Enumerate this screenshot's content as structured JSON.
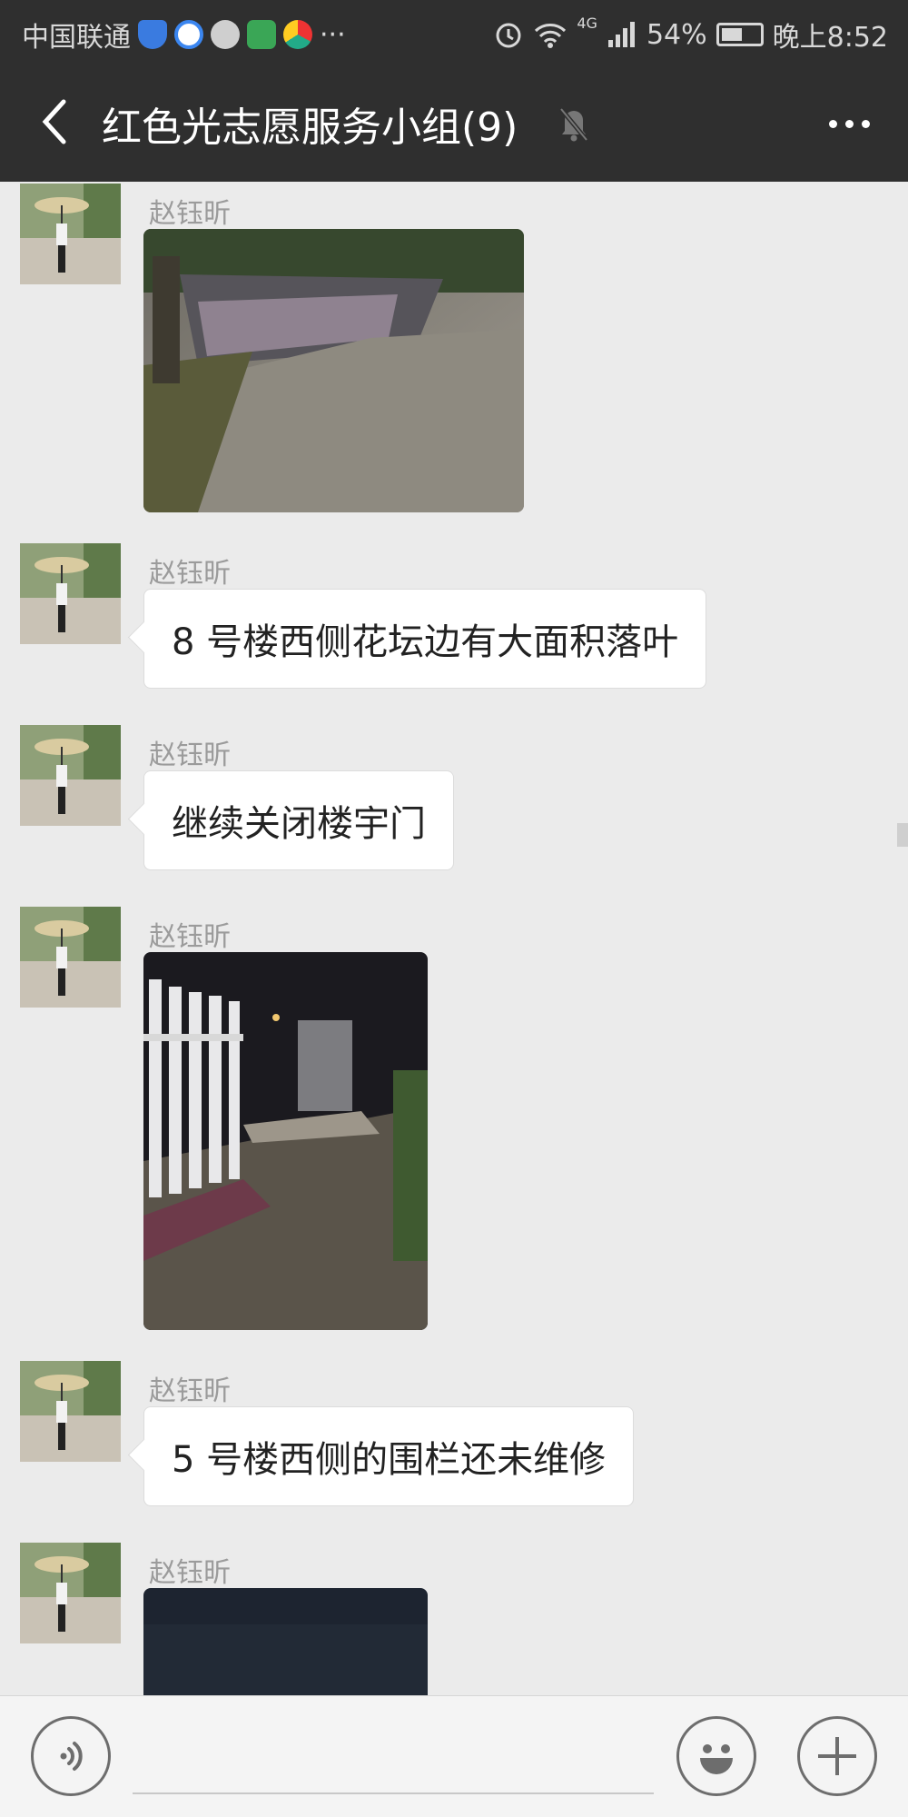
{
  "status_bar": {
    "carrier": "中国联通",
    "more": "···",
    "network": "4G",
    "battery": "54%",
    "time": "晚上8:52",
    "icons": [
      "shield-app-icon",
      "rings-app-icon",
      "chat-app-icon",
      "green-app-icon",
      "browser-app-icon",
      "alarm-icon",
      "wifi-icon",
      "signal-icon",
      "battery-icon"
    ]
  },
  "header": {
    "title": "红色光志愿服务小组(9)",
    "icons": [
      "back-arrow-icon",
      "mute-bell-icon",
      "more-dots-icon"
    ]
  },
  "messages": [
    {
      "sender": "赵钰昕",
      "type": "image",
      "description": "path"
    },
    {
      "sender": "赵钰昕",
      "type": "text",
      "text": "8 号楼西侧花坛边有大面积落叶"
    },
    {
      "sender": "赵钰昕",
      "type": "text",
      "text": "继续关闭楼宇门"
    },
    {
      "sender": "赵钰昕",
      "type": "image",
      "description": "fence"
    },
    {
      "sender": "赵钰昕",
      "type": "text",
      "text": "5 号楼西侧的围栏还未维修"
    },
    {
      "sender": "赵钰昕",
      "type": "image",
      "description": "dark"
    }
  ],
  "input_bar": {
    "placeholder": "",
    "icons": [
      "voice-icon",
      "emoji-icon",
      "plus-icon"
    ]
  },
  "colors": {
    "header_bg": "#2f2f2f",
    "chat_bg": "#ebebeb",
    "bubble_bg": "#ffffff",
    "sender_text": "#9b9b9b"
  }
}
